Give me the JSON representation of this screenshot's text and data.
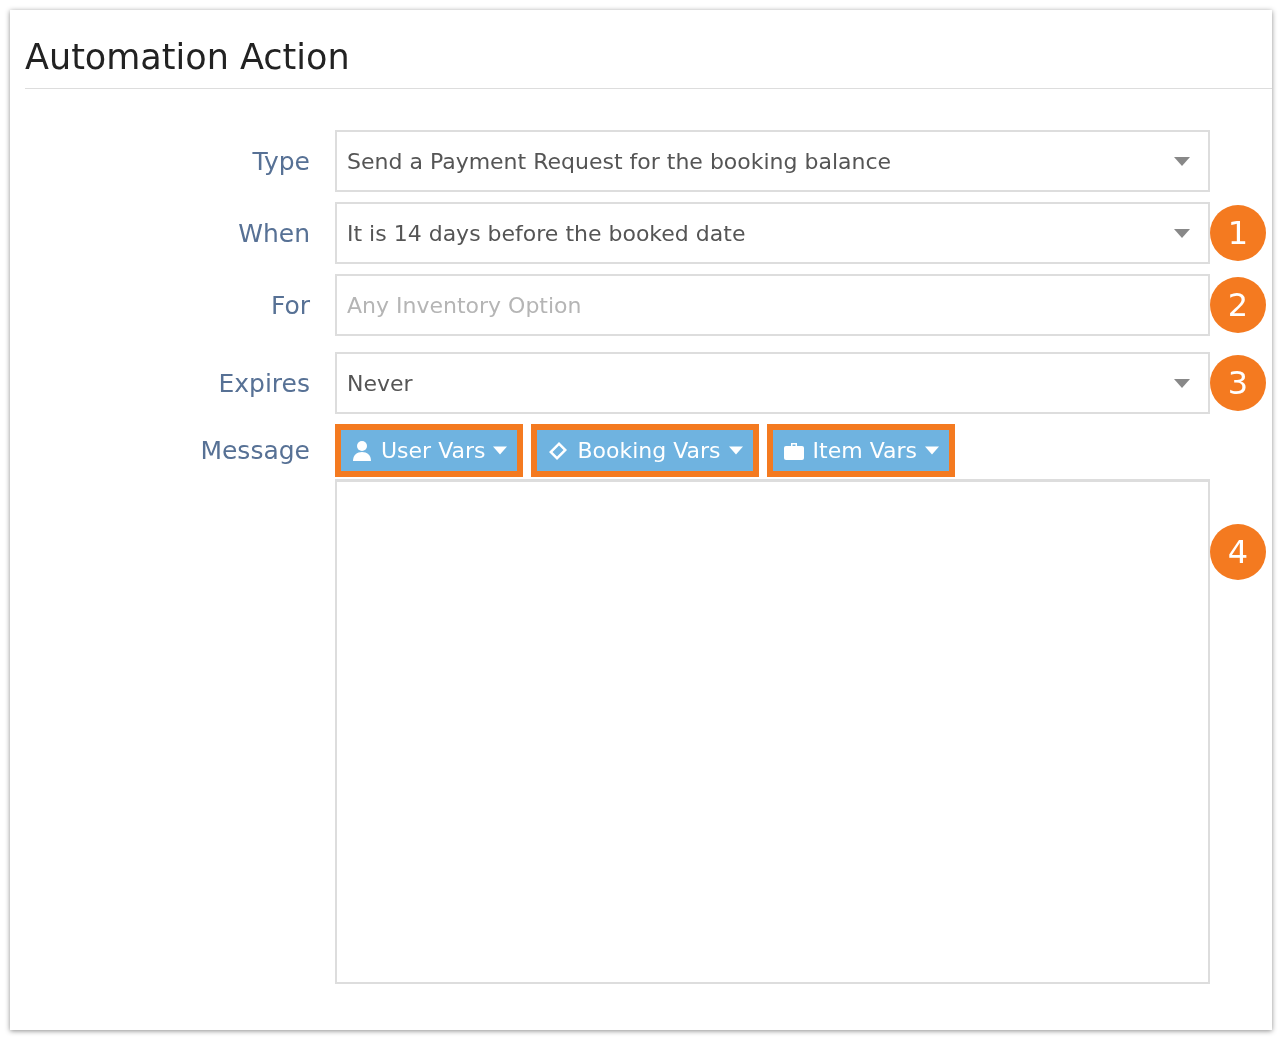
{
  "title": "Automation Action",
  "fields": [
    {
      "label": "Type",
      "kind": "select",
      "value": "Send a Payment Request for the booking balance"
    },
    {
      "label": "When",
      "kind": "select",
      "value": "It is 14 days before the booked date",
      "badge": "1"
    },
    {
      "label": "For",
      "kind": "input",
      "placeholder": "Any Inventory Option",
      "badge": "2"
    },
    {
      "label": "Expires",
      "kind": "select",
      "value": "Never",
      "badge": "3"
    }
  ],
  "message": {
    "label": "Message",
    "badge": "4",
    "buttons": [
      {
        "label": "User Vars",
        "kind": "user",
        "highlighted": true
      },
      {
        "label": "Booking Vars",
        "kind": "ticket",
        "highlighted": true
      },
      {
        "label": "Item Vars",
        "kind": "briefcase",
        "highlighted": true
      }
    ]
  }
}
